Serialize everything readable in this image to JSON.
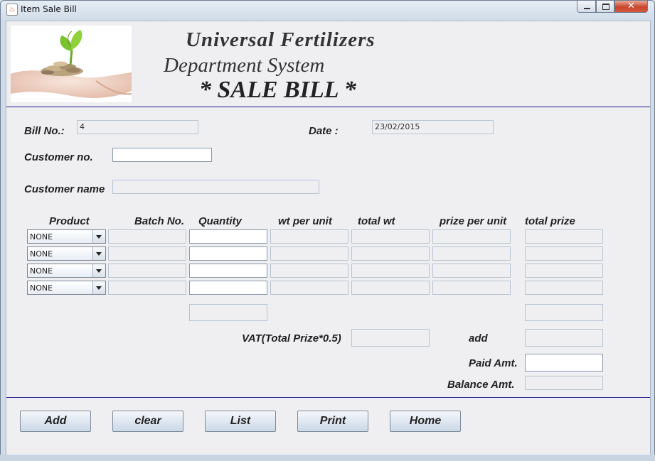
{
  "window": {
    "title": "Item Sale Bill"
  },
  "header": {
    "line1": "Universal Fertilizers",
    "line2": "Department System",
    "line3": "* SALE BILL *"
  },
  "form": {
    "bill_no_label": "Bill No.:",
    "bill_no": "4",
    "date_label": "Date :",
    "date": "23/02/2015",
    "customer_no_label": "Customer no.",
    "customer_no": "",
    "customer_name_label": "Customer name",
    "customer_name": ""
  },
  "table": {
    "columns": [
      "Product",
      "Batch No.",
      "Quantity",
      "wt per unit",
      "total wt",
      "prize per unit",
      "total prize"
    ],
    "rows": [
      {
        "product": "NONE",
        "batch": "",
        "quantity": "",
        "wt_per_unit": "",
        "total_wt": "",
        "prize_per_unit": "",
        "total_prize": ""
      },
      {
        "product": "NONE",
        "batch": "",
        "quantity": "",
        "wt_per_unit": "",
        "total_wt": "",
        "prize_per_unit": "",
        "total_prize": ""
      },
      {
        "product": "NONE",
        "batch": "",
        "quantity": "",
        "wt_per_unit": "",
        "total_wt": "",
        "prize_per_unit": "",
        "total_prize": ""
      },
      {
        "product": "NONE",
        "batch": "",
        "quantity": "",
        "wt_per_unit": "",
        "total_wt": "",
        "prize_per_unit": "",
        "total_prize": ""
      }
    ]
  },
  "totals": {
    "quantity_total": "",
    "prize_total": "",
    "vat_label": "VAT(Total Prize*0.5)",
    "vat": "",
    "add_label": "add",
    "add": "",
    "paid_label": "Paid Amt.",
    "paid": "",
    "balance_label": "Balance Amt.",
    "balance": ""
  },
  "buttons": {
    "add": "Add",
    "clear": "clear",
    "list": "List",
    "print": "Print",
    "home": "Home"
  }
}
